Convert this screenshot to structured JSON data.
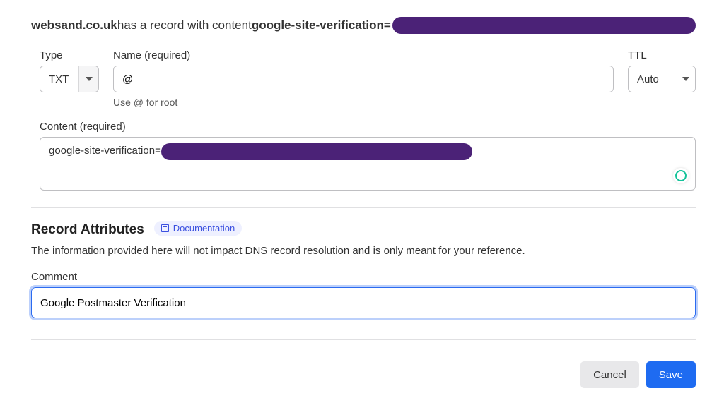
{
  "heading": {
    "domain": "websand.co.uk",
    "mid": " has a record with content ",
    "prefix": "google-site-verification="
  },
  "fields": {
    "type": {
      "label": "Type",
      "value": "TXT"
    },
    "name": {
      "label": "Name (required)",
      "value": "@",
      "help": "Use @ for root"
    },
    "ttl": {
      "label": "TTL",
      "value": "Auto"
    },
    "content": {
      "label": "Content (required)",
      "value_prefix": "google-site-verification="
    }
  },
  "attributes": {
    "title": "Record Attributes",
    "doc_link": "Documentation",
    "description": "The information provided here will not impact DNS record resolution and is only meant for your reference.",
    "comment": {
      "label": "Comment",
      "value": "Google Postmaster Verification"
    }
  },
  "buttons": {
    "cancel": "Cancel",
    "save": "Save"
  }
}
